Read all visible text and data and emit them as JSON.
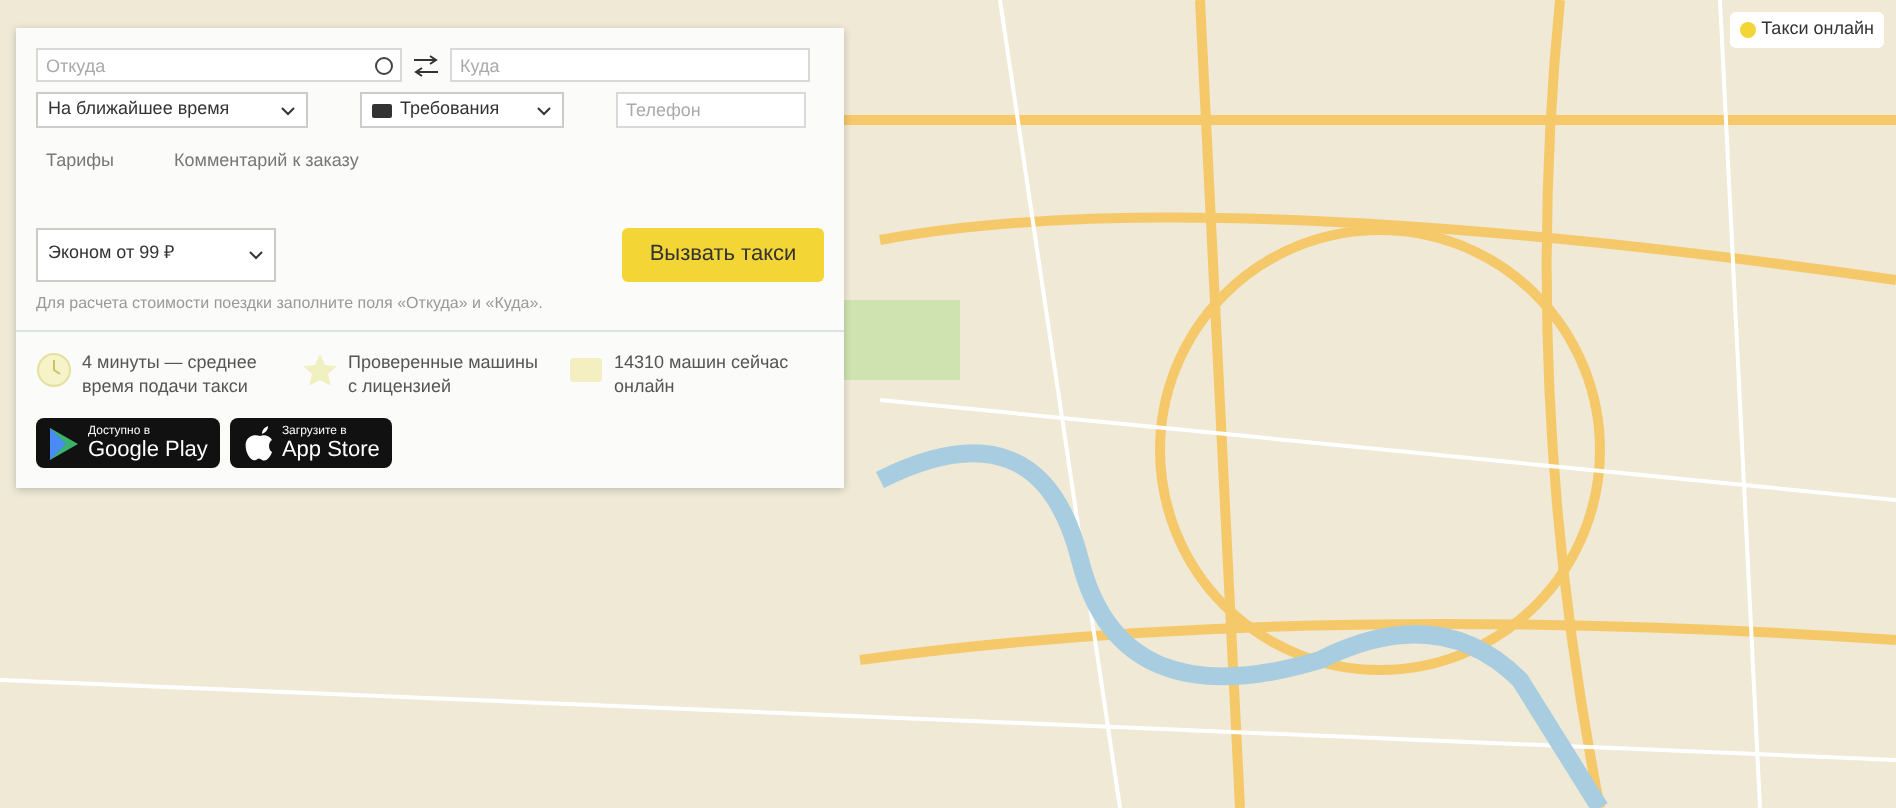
{
  "order_form": {
    "from": {
      "placeholder": "Откуда"
    },
    "to": {
      "placeholder": "Куда"
    },
    "when": {
      "value": "На ближайшее время"
    },
    "requirements": {
      "value": "Требования"
    },
    "phone": {
      "placeholder": "Телефон"
    },
    "links": [
      "Тарифы",
      "Комментарий к заказу"
    ],
    "tariff": {
      "value": "Эконом от 99 ₽"
    },
    "submit": "Вызвать такси",
    "note": "Для расчета стоимости поездки заполните поля «Откуда» и «Куда»."
  },
  "features": [
    {
      "kind": "clock",
      "text": "4 минуты — среднее время подачи такси"
    },
    {
      "kind": "star",
      "text": "Проверенные машины с лицензией"
    },
    {
      "kind": "card",
      "text": "14310 машин сейчас онлайн"
    }
  ],
  "stores": [
    {
      "kind": "google",
      "small": "Доступно в",
      "big": "Google Play"
    },
    {
      "kind": "apple",
      "small": "Загрузите в",
      "big": "App Store"
    }
  ],
  "online_badge": "Такси онлайн"
}
